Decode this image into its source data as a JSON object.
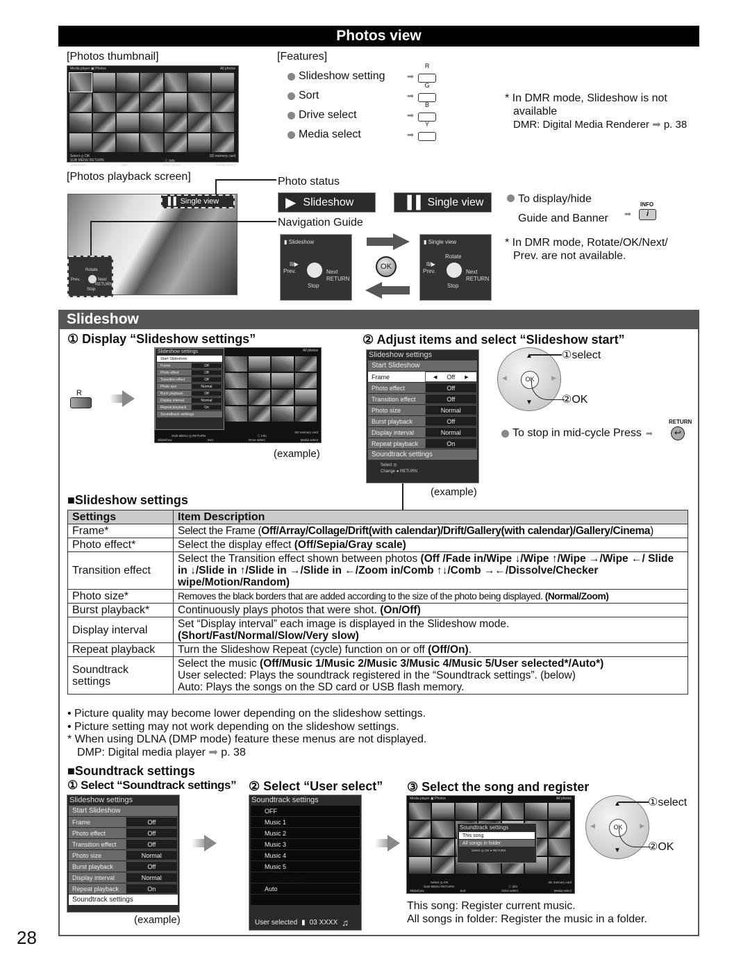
{
  "page_number": "28",
  "header": {
    "title": "Photos view"
  },
  "thumbnail_section": {
    "label": "[Photos thumbnail]",
    "screen": {
      "top_left": "Media player",
      "top_mid": "Photos",
      "top_right": "All photos",
      "footer_select": "Select",
      "footer_ok": "OK",
      "footer_submenu": "SUB MENU",
      "footer_return": "RETURN",
      "footer_info": "Info",
      "footer_card": "SD memory card",
      "footer_buttons": [
        "Slideshow",
        "Sort",
        "Drive select",
        "Media select"
      ]
    }
  },
  "features": {
    "label": "[Features]",
    "items": [
      {
        "label": "Slideshow setting",
        "button": "R"
      },
      {
        "label": "Sort",
        "button": "G"
      },
      {
        "label": "Drive select",
        "button": "B"
      },
      {
        "label": "Media select",
        "button": "Y"
      }
    ],
    "note_line1": "* In DMR mode, Slideshow is not",
    "note_line2": "available",
    "note_line3": "DMR: Digital Media Renderer",
    "note_page": "p. 38"
  },
  "playback_section": {
    "label": "[Photos playback screen]",
    "single_view_badge": "Single view",
    "nav_rotate": "Rotate",
    "nav_prev": "Prev.",
    "nav_next": "Next",
    "nav_return": "RETURN",
    "nav_stop": "Stop",
    "photo_status_label": "Photo status",
    "status_slideshow": "Slideshow",
    "status_single": "Single view",
    "navigation_guide_label": "Navigation Guide",
    "guide_slideshow": {
      "title": "Slideshow",
      "play": "II/▶",
      "prev": "Prev.",
      "next": "Next",
      "return": "RETURN",
      "stop": "Stop"
    },
    "guide_single": {
      "title": "Single view",
      "rotate": "Rotate",
      "play": "II/▶",
      "prev": "Prev.",
      "next": "Next",
      "return": "RETURN",
      "stop": "Stop"
    },
    "ok_label": "OK",
    "display_hide_line1": "To display/hide",
    "display_hide_line2": "Guide and Banner",
    "info_label": "INFO",
    "dmr_note_line1": "* In DMR mode, Rotate/OK/Next/",
    "dmr_note_line2": "Prev. are not available."
  },
  "slideshow": {
    "title": "Slideshow",
    "step1": {
      "title": "① Display “Slideshow settings”",
      "button": "R",
      "example": "(example)"
    },
    "step2": {
      "title": "② Adjust items and select “Slideshow start”",
      "select_label": "①select",
      "ok_label": "②OK",
      "dpad_ok": "OK",
      "stop_text": "To stop in mid-cycle Press",
      "return_label": "RETURN",
      "example": "(example)"
    },
    "menu": {
      "title": "Slideshow settings",
      "start": "Start Slideshow",
      "rows": [
        {
          "key": "Frame",
          "value": "Off"
        },
        {
          "key": "Photo effect",
          "value": "Off"
        },
        {
          "key": "Transition effect",
          "value": "Off"
        },
        {
          "key": "Photo size",
          "value": "Normal"
        },
        {
          "key": "Burst playback",
          "value": "Off"
        },
        {
          "key": "Display interval",
          "value": "Normal"
        },
        {
          "key": "Repeat playback",
          "value": "On"
        }
      ],
      "soundtrack": "Soundtrack settings",
      "guide_select": "Select",
      "guide_change": "Change",
      "guide_return": "RETURN",
      "all_photos": "All photos"
    },
    "settings_heading": "■Slideshow settings",
    "table": {
      "headers": [
        "Settings",
        "Item Description"
      ],
      "rows": [
        {
          "setting": "Frame*",
          "desc": "Select the Frame (",
          "bold": "Off/Array/Collage/Drift(with calendar)/Drift/Gallery(with calendar)/Gallery/Cinema",
          "tail": ")"
        },
        {
          "setting": "Photo effect*",
          "desc": "Select the display effect ",
          "bold": "(Off/Sepia/Gray scale)",
          "tail": ""
        },
        {
          "setting": "Transition effect",
          "desc": "Select the Transition effect shown between photos ",
          "bold": "(Off /Fade in/Wipe ↓/Wipe ↑/Wipe →/Wipe ←/ Slide in ↓/Slide in ↑/Slide in →/Slide in ←/Zoom in/Comb ↑↓/Comb →←/Dissolve/Checker wipe/Motion/Random)",
          "tail": ""
        },
        {
          "setting": "Photo size*",
          "desc": "Removes the black borders that are added according to the size of the photo being displayed. ",
          "bold": "(Normal/Zoom)",
          "tail": ""
        },
        {
          "setting": "Burst playback*",
          "desc": "Continuously plays photos that were shot. ",
          "bold": "(On/Off)",
          "tail": ""
        },
        {
          "setting": "Display interval",
          "desc": "Set “Display interval” each image is displayed in the Slideshow mode.",
          "bold": "(Short/Fast/Normal/Slow/Very slow)",
          "tail": ""
        },
        {
          "setting": "Repeat playback",
          "desc": "Turn the Slideshow Repeat (cycle) function on or off ",
          "bold": "(Off/On)",
          "tail": "."
        },
        {
          "setting": "Soundtrack settings",
          "desc": "Select the music ",
          "bold": "(Off/Music 1/Music 2/Music 3/Music 4/Music 5/User selected*/Auto*)",
          "tail": "",
          "line2": "User selected: Plays the soundtrack registered in the “Soundtrack settings”. (below)",
          "line3": "Auto: Plays the songs on the SD card or USB flash memory."
        }
      ]
    },
    "notes": [
      "• Picture quality may become lower depending on the slideshow settings.",
      "• Picture setting may not work depending on the slideshow settings.",
      "* When using DLNA (DMP mode) feature these menus are not displayed."
    ],
    "dmp_note": "DMP: Digital media player",
    "dmp_page": "p. 38",
    "soundtrack": {
      "heading": "■Soundtrack settings",
      "step1": "① Select “Soundtrack settings”",
      "step2": "② Select “User select”",
      "step3": "③ Select the song and register",
      "example": "(example)",
      "menu_title": "Soundtrack settings",
      "options": [
        "OFF",
        "Music 1",
        "Music 2",
        "Music 3",
        "Music 4",
        "Music 5",
        "User selected",
        "Auto"
      ],
      "selected_option": "User selected",
      "footer_label": "User selected",
      "footer_track": "03 XXXX",
      "popup_title": "Soundtrack settings",
      "popup_options": [
        "This song",
        "All songs in folder"
      ],
      "select_label": "①select",
      "ok_label": "②OK",
      "dpad_ok": "OK",
      "desc_line1": "This song: Register current music.",
      "desc_line2": "All songs in folder: Register the music in a folder."
    }
  }
}
